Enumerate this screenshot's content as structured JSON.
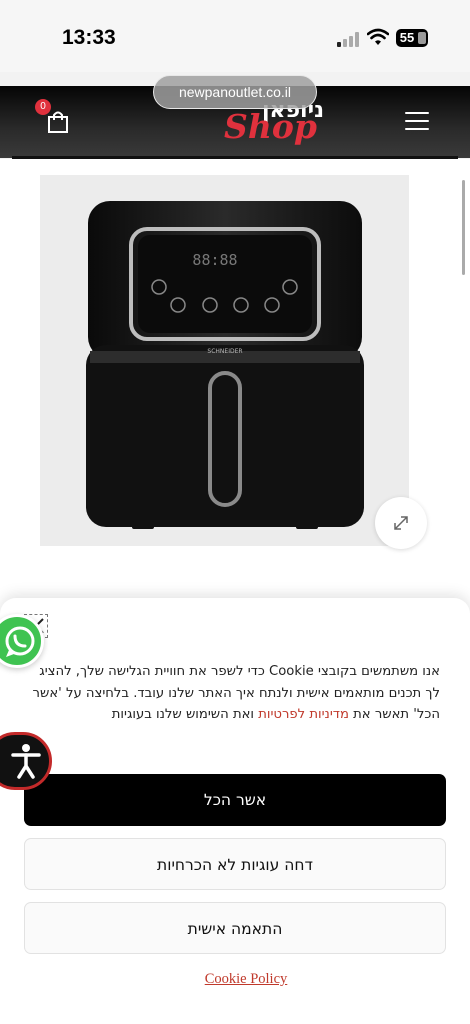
{
  "status_bar": {
    "time": "13:33",
    "battery": "55",
    "icons": [
      "signal-icon",
      "wifi-icon",
      "battery-icon"
    ]
  },
  "browser": {
    "url": "newpanoutlet.co.il"
  },
  "header": {
    "cart_count": "0",
    "logo_hebrew": "ניופאן",
    "logo_shop": "Shop",
    "icons": [
      "cart-icon",
      "menu-icon"
    ]
  },
  "product": {
    "image_brand": "SCHNEIDER",
    "display_digits": "88:88",
    "expand_icon": "expand-icon"
  },
  "cookie_banner": {
    "text_before_link": "אנו משתמשים בקובצי Cookie כדי לשפר את חוויית הגלישה שלך, להציג לך תכנים מותאמים אישית ולנתח איך האתר שלנו עובד. בלחיצה על 'אשר הכל' תאשר את ",
    "link_text": "מדיניות לפרטיות",
    "text_after_link": " ואת השימוש שלנו בעוגיות",
    "accept_all": "אשר הכל",
    "reject_non_essential": "דחה עוגיות לא הכרחיות",
    "customize": "התאמה אישית",
    "cookie_policy": "Cookie Policy"
  },
  "floating": {
    "whatsapp_icon": "whatsapp-icon",
    "accessibility_icon": "accessibility-icon"
  },
  "colors": {
    "accent": "#e0313d",
    "link": "#c0392b",
    "whatsapp": "#3fc351",
    "header_bg": "#111111"
  }
}
